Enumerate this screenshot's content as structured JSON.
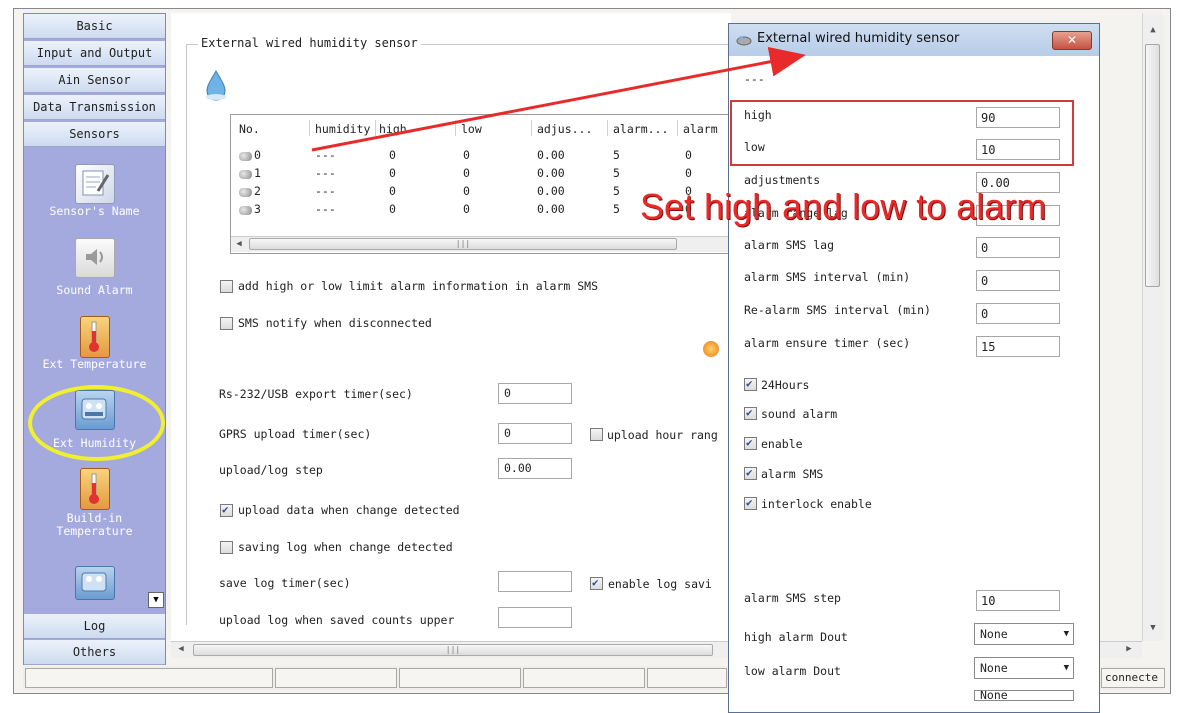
{
  "sidebar": {
    "top_categories": [
      "Basic",
      "Input and Output",
      "Ain Sensor",
      "Data Transmission",
      "Sensors"
    ],
    "items": [
      {
        "label": "Sensor's Name",
        "icon": "notepad-icon"
      },
      {
        "label": "Sound Alarm",
        "icon": "speaker-icon"
      },
      {
        "label": "Ext Temperature",
        "icon": "thermometer-icon"
      },
      {
        "label": "Ext Humidity",
        "icon": "humidity-sensor-icon"
      },
      {
        "label": "Build-in\nTemperature",
        "icon": "thermometer-icon"
      }
    ],
    "bottom_categories": [
      "Log",
      "Others"
    ]
  },
  "main": {
    "group_title": "External wired humidity sensor",
    "table": {
      "columns": [
        "No.",
        "humidity",
        "high",
        "low",
        "adjus...",
        "alarm...",
        "alarm"
      ],
      "rows": [
        [
          "0",
          "---",
          "0",
          "0",
          "0.00",
          "5",
          "0"
        ],
        [
          "1",
          "---",
          "0",
          "0",
          "0.00",
          "5",
          "0"
        ],
        [
          "2",
          "---",
          "0",
          "0",
          "0.00",
          "5",
          "0"
        ],
        [
          "3",
          "---",
          "0",
          "0",
          "0.00",
          "5",
          "0"
        ]
      ]
    },
    "checkbox_sms_alarm": "add high or low limit alarm information in alarm SMS",
    "checkbox_sms_disconnect": "SMS notify when disconnected",
    "rs232_label": "Rs-232/USB export timer(sec)",
    "rs232_value": "0",
    "gprs_label": "GPRS upload timer(sec)",
    "gprs_value": "0",
    "upload_hour_range": "upload hour rang",
    "upload_step_label": "upload/log step",
    "upload_step_value": "0.00",
    "upload_change": "upload data when change detected",
    "saving_change": "saving log when change detected",
    "save_log_timer_label": "save log timer(sec)",
    "save_log_timer_value": "",
    "enable_log_saving": "enable log savi",
    "upload_log_counts_label": "upload log when saved counts upper",
    "upload_log_counts_value": ""
  },
  "status_bar": {
    "connection": "connecte"
  },
  "dialog": {
    "title": "External wired humidity sensor",
    "subtitle": "---",
    "fields": [
      {
        "label": "high",
        "value": "90"
      },
      {
        "label": "low",
        "value": "10"
      },
      {
        "label": "adjustments",
        "value": "0.00"
      },
      {
        "label": "alarm range lag",
        "value": ""
      },
      {
        "label": "alarm SMS lag",
        "value": "0"
      },
      {
        "label": "alarm SMS interval (min)",
        "value": "0"
      },
      {
        "label": "Re-alarm SMS interval (min)",
        "value": "0"
      },
      {
        "label": "alarm ensure timer (sec)",
        "value": "15"
      }
    ],
    "checkboxes": [
      "24Hours",
      "sound alarm",
      "enable",
      "alarm SMS",
      "interlock enable"
    ],
    "sms_step_label": "alarm SMS step",
    "sms_step_value": "10",
    "high_dout_label": "high alarm Dout",
    "high_dout_value": "None",
    "low_dout_label": "low alarm Dout",
    "low_dout_value": "None",
    "third_dout_value": "None"
  },
  "annotation": {
    "text": "Set high and low to alarm",
    "color": "#e82a2a"
  }
}
